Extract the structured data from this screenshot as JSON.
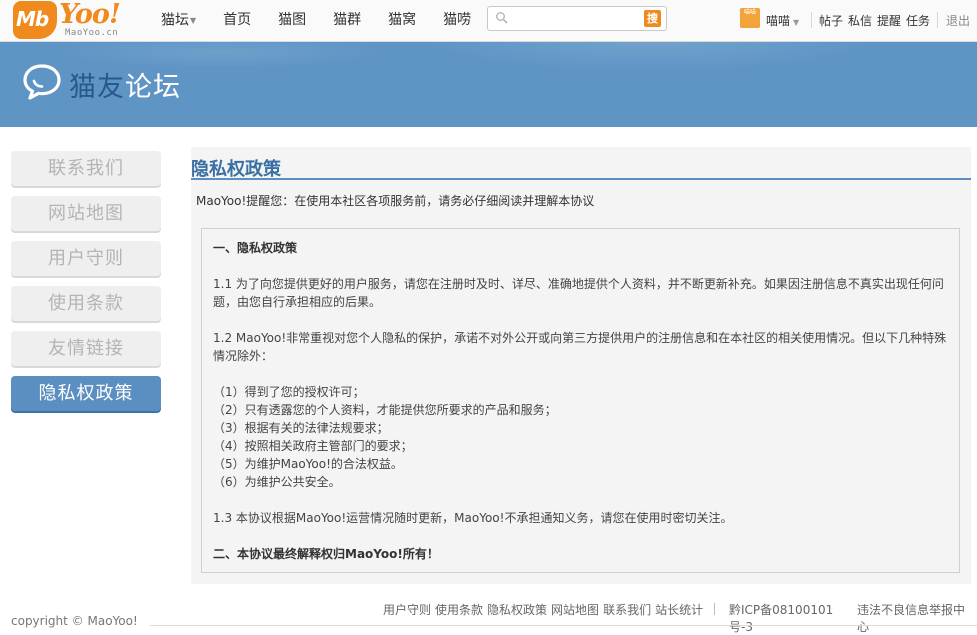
{
  "brand": {
    "badge": "Mb",
    "word": "Yoo!",
    "sub": "MaoYoo.cn",
    "accent": "#f08a1d"
  },
  "nav": {
    "items": [
      {
        "label": "猫坛",
        "caret": "▼"
      },
      {
        "label": "首页"
      },
      {
        "label": "猫图"
      },
      {
        "label": "猫群"
      },
      {
        "label": "猫窝"
      },
      {
        "label": "猫唠"
      }
    ]
  },
  "search": {
    "placeholder": "",
    "button_label": "搜",
    "icon": "search-icon"
  },
  "user": {
    "avatar_text": "喵喵",
    "name": "喵喵",
    "caret": "▼",
    "links": [
      "帖子",
      "私信",
      "提醒",
      "任务"
    ],
    "logout": "退出"
  },
  "banner": {
    "title_highlight": "猫友",
    "title_rest": "论坛",
    "icon": "speech-bubble-icon",
    "color": "#5f95c5"
  },
  "sidebar": {
    "items": [
      {
        "label": "联系我们"
      },
      {
        "label": "网站地图"
      },
      {
        "label": "用户守则"
      },
      {
        "label": "使用条款"
      },
      {
        "label": "友情链接"
      },
      {
        "label": "隐私权政策",
        "active": true
      }
    ],
    "active_color": "#5b8ec1"
  },
  "content": {
    "title": "隐私权政策",
    "reminder": "MaoYoo!提醒您：在使用本社区各项服务前，请务必仔细阅读并理解本协议",
    "paragraphs": {
      "h1": "一、隐私权政策",
      "p11_a": "1.1 为了向您提供更好的用户服务，请您在注册时及时、详尽、准确地提供个人资料，并不断更新补充。如果因注册信息不真实出现任何问",
      "p11_b": "题，由您自行承担相应的后果。",
      "p12_a": "1.2 MaoYoo!非常重视对您个人隐私的保护，承诺不对外公开或向第三方提供用户的注册信息和在本社区的相关使用情况。但以下几种特殊",
      "p12_b": "情况除外：",
      "l1": "（1）得到了您的授权许可；",
      "l2": "（2）只有透露您的个人资料，才能提供您所要求的产品和服务；",
      "l3": "（3）根据有关的法律法规要求；",
      "l4": "（4）按照相关政府主管部门的要求；",
      "l5": "（5）为维护MaoYoo!的合法权益。",
      "l6": "（6）为维护公共安全。",
      "p13": "1.3 本协议根据MaoYoo!运营情况随时更新，MaoYoo!不承担通知义务，请您在使用时密切关注。",
      "h2": "二、本协议最终解释权归MaoYoo!所有！"
    }
  },
  "footer": {
    "links": [
      "用户守则",
      "使用条款",
      "隐私权政策",
      "网站地图",
      "联系我们",
      "站长统计"
    ],
    "icp": "黔ICP备08100101号-3",
    "report": "违法不良信息举报中心",
    "copyright": "copyright © MaoYoo!"
  }
}
